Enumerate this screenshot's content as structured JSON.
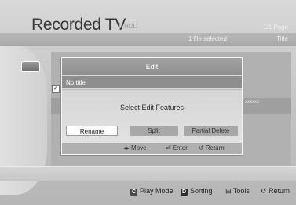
{
  "header": {
    "title": "Recorded TV",
    "source": "HDD",
    "page": "1/1 Page",
    "selected_count": "1 file selected",
    "sort": "Title"
  },
  "list": {
    "row_text": "xxxxxx"
  },
  "dialog": {
    "title": "Edit",
    "item": "No title",
    "prompt": "Select Edit Features",
    "options": [
      "Rename",
      "Split",
      "Partial Delete"
    ],
    "selected_option": "Rename",
    "hints": {
      "move": "Move",
      "enter": "Enter",
      "return": "Return"
    }
  },
  "footer": {
    "play_key": "C",
    "play_label": "Play Mode",
    "sort_key": "D",
    "sort_label": "Sorting",
    "tools_label": "Tools",
    "return_label": "Return"
  },
  "icons": [
    "move-arrows-icon",
    "enter-icon",
    "return-icon",
    "tools-icon"
  ]
}
